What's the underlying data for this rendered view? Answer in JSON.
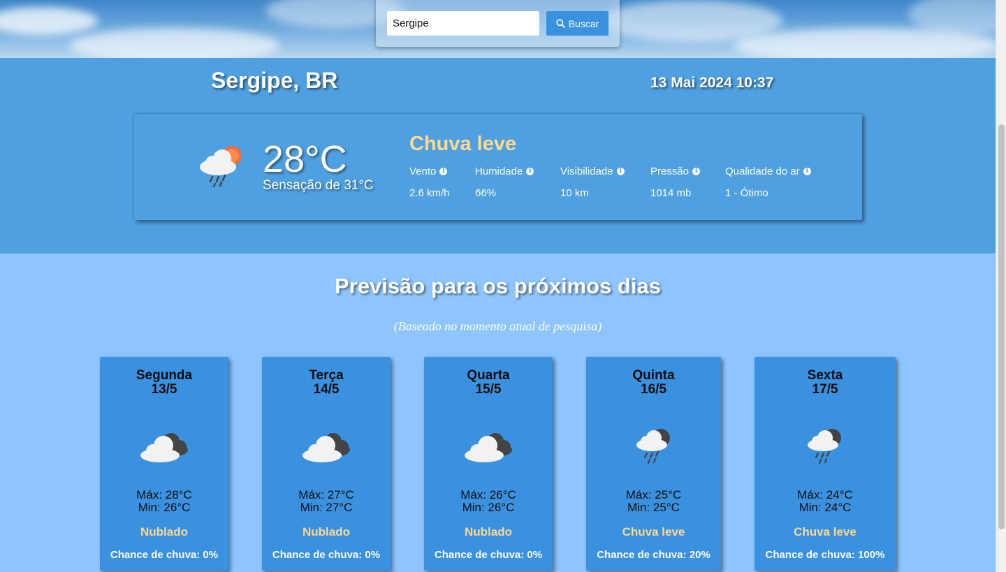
{
  "search": {
    "value": "Sergipe",
    "button_label": "Buscar"
  },
  "current": {
    "location": "Sergipe, BR",
    "datetime": "13 Mai 2024 10:37",
    "temperature": "28°C",
    "feels_like": "Sensação de 31°C",
    "condition": "Chuva leve",
    "icon": "rain-cloud-sun-icon",
    "metrics": [
      {
        "label": "Vento",
        "value": "2.6 km/h"
      },
      {
        "label": "Humidade",
        "value": "66%"
      },
      {
        "label": "Visibilidade",
        "value": "10 km"
      },
      {
        "label": "Pressão",
        "value": "1014 mb"
      },
      {
        "label": "Qualidade do ar",
        "value": "1 - Ótimo"
      }
    ]
  },
  "forecast": {
    "title": "Previsão para os próximos dias",
    "subtitle": "(Baseado no momento atual de pesquisa)",
    "days": [
      {
        "name": "Segunda",
        "date": "13/5",
        "max": "Máx: 28°C",
        "min": "Min: 26°C",
        "condition": "Nublado",
        "rain": "Chance de chuva: 0%",
        "icon": "cloudy-icon"
      },
      {
        "name": "Terça",
        "date": "14/5",
        "max": "Máx: 27°C",
        "min": "Min: 27°C",
        "condition": "Nublado",
        "rain": "Chance de chuva: 0%",
        "icon": "cloudy-icon"
      },
      {
        "name": "Quarta",
        "date": "15/5",
        "max": "Máx: 26°C",
        "min": "Min: 26°C",
        "condition": "Nublado",
        "rain": "Chance de chuva: 0%",
        "icon": "cloudy-icon"
      },
      {
        "name": "Quinta",
        "date": "16/5",
        "max": "Máx: 25°C",
        "min": "Min: 25°C",
        "condition": "Chuva leve",
        "rain": "Chance de chuva: 20%",
        "icon": "rain-cloud-moon-icon"
      },
      {
        "name": "Sexta",
        "date": "17/5",
        "max": "Máx: 24°C",
        "min": "Min: 24°C",
        "condition": "Chuva leve",
        "rain": "Chance de chuva: 100%",
        "icon": "rain-cloud-moon-icon"
      }
    ]
  },
  "colors": {
    "banner": "#4fa0e0",
    "forecast_bg": "#8ec5ff",
    "card": "#3a91df",
    "condition_text": "#ffd98f"
  }
}
